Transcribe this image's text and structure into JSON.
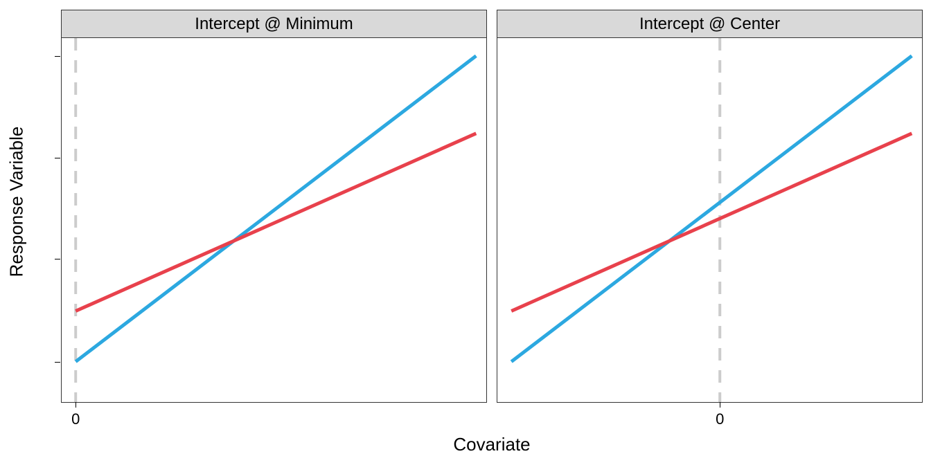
{
  "xlabel": "Covariate",
  "ylabel": "Response Variable",
  "zero_label": "0",
  "panels": [
    {
      "title": "Intercept @ Minimum",
      "zero_x_frac": 0.033
    },
    {
      "title": "Intercept @ Center",
      "zero_x_frac": 0.524
    }
  ],
  "colors": {
    "blue": "#2ca8e0",
    "red": "#e8414c",
    "grid": "#cccccc",
    "border": "#333333"
  },
  "chart_data": [
    {
      "type": "line",
      "title": "Intercept @ Minimum",
      "xlabel": "Covariate",
      "ylabel": "Response Variable",
      "x_range_frac": [
        0.033,
        0.976
      ],
      "y_range_frac": [
        0.02,
        0.98
      ],
      "vline_at_frac": 0.033,
      "series": [
        {
          "name": "blue",
          "color": "#2ca8e0",
          "x_frac": [
            0.033,
            0.976
          ],
          "y_frac": [
            0.111,
            0.951
          ]
        },
        {
          "name": "red",
          "color": "#e8414c",
          "x_frac": [
            0.033,
            0.976
          ],
          "y_frac": [
            0.25,
            0.738
          ]
        }
      ],
      "y_ticks_frac": [
        0.111,
        0.393,
        0.672,
        0.951
      ],
      "x_ticks": [
        {
          "label": "0",
          "x_frac": 0.033
        }
      ]
    },
    {
      "type": "line",
      "title": "Intercept @ Center",
      "xlabel": "Covariate",
      "ylabel": "Response Variable",
      "x_range_frac": [
        0.033,
        0.976
      ],
      "y_range_frac": [
        0.02,
        0.98
      ],
      "vline_at_frac": 0.524,
      "series": [
        {
          "name": "blue",
          "color": "#2ca8e0",
          "x_frac": [
            0.033,
            0.976
          ],
          "y_frac": [
            0.111,
            0.951
          ]
        },
        {
          "name": "red",
          "color": "#e8414c",
          "x_frac": [
            0.033,
            0.976
          ],
          "y_frac": [
            0.25,
            0.738
          ]
        }
      ],
      "y_ticks_frac": [
        0.111,
        0.393,
        0.672,
        0.951
      ],
      "x_ticks": [
        {
          "label": "0",
          "x_frac": 0.524
        }
      ]
    }
  ]
}
